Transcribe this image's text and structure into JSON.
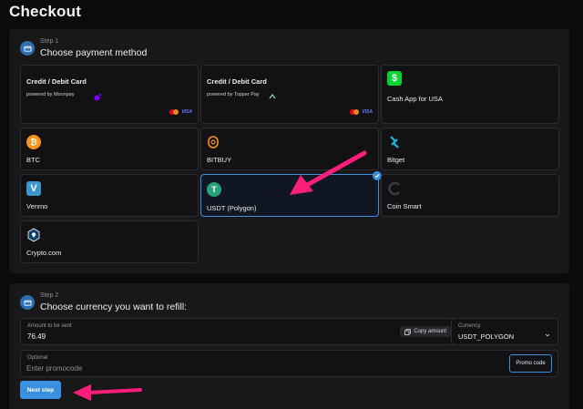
{
  "page": {
    "title": "Checkout"
  },
  "step1": {
    "label": "Step 1",
    "title": "Choose payment method",
    "methods": [
      {
        "label": "Credit / Debit Card",
        "powered": "powered by Moonpay",
        "cards": [
          "mastercard",
          "VISA"
        ],
        "icon": "moonpay-icon"
      },
      {
        "label": "Credit / Debit Card",
        "powered": "powered by Topper Pay",
        "cards": [
          "mastercard",
          "VISA"
        ],
        "icon": "topper-icon"
      },
      {
        "label": "Cash App for USA",
        "icon": "cashapp-icon",
        "color": "#00d632"
      },
      {
        "label": "BTC",
        "icon": "bitcoin-icon",
        "color": "#f7931a"
      },
      {
        "label": "BITBUY",
        "icon": "bitbuy-icon",
        "color": "#f7931a"
      },
      {
        "label": "Bitget",
        "icon": "bitget-icon",
        "color": "#1bb7d9"
      },
      {
        "label": "Venmo",
        "icon": "venmo-icon",
        "color": "#3d95ce"
      },
      {
        "label": "USDT (Polygon)",
        "icon": "tether-icon",
        "color": "#26a17b",
        "selected": true
      },
      {
        "label": "Coin Smart",
        "icon": "coinsmart-icon"
      },
      {
        "label": "Crypto.com",
        "icon": "cryptocom-icon",
        "color": "#103f68"
      }
    ]
  },
  "step2": {
    "label": "Step 2",
    "title": "Choose currency you want to refill:",
    "amount": {
      "label": "Amount to be sent",
      "value": "76.49",
      "copy_label": "Copy amount"
    },
    "currency": {
      "label": "Currency",
      "value": "USDT_POLYGON"
    },
    "promo": {
      "label": "Optional",
      "placeholder": "Enter promocode",
      "button": "Promo code"
    },
    "next_button": "Next step"
  },
  "colors": {
    "accent": "#3b8fe0",
    "annotation_arrow": "#ff1f7a",
    "panel": "#18181b",
    "background": "#0b0b0c"
  }
}
